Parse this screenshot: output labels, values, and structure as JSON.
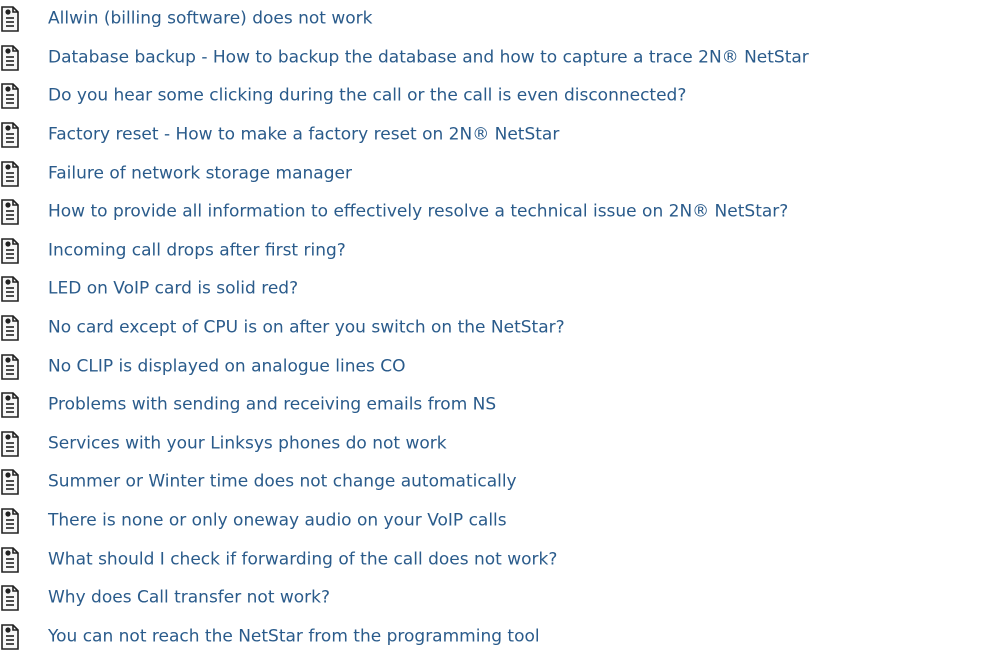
{
  "colors": {
    "link": "#2a5b8b",
    "icon": "#222222",
    "icon_fill": "#f7f7f7"
  },
  "icons": {
    "page": "page-icon"
  },
  "items": [
    {
      "label": "Allwin (billing software) does not work"
    },
    {
      "label": "Database backup - How to backup the database and how to capture a trace 2N® NetStar"
    },
    {
      "label": "Do you hear some clicking during the call or the call is even disconnected?"
    },
    {
      "label": "Factory reset - How to make a factory reset on 2N® NetStar"
    },
    {
      "label": "Failure of network storage manager"
    },
    {
      "label": "How to provide all information to effectively resolve a technical issue on 2N® NetStar?"
    },
    {
      "label": "Incoming call drops after first ring?"
    },
    {
      "label": "LED on VoIP card is solid red?"
    },
    {
      "label": "No card except of CPU is on after you switch on the NetStar?"
    },
    {
      "label": "No CLIP is displayed on analogue lines CO"
    },
    {
      "label": "Problems with sending and receiving emails from NS"
    },
    {
      "label": "Services with your Linksys phones do not work"
    },
    {
      "label": "Summer or Winter time does not change automatically"
    },
    {
      "label": "There is none or only oneway audio on your VoIP calls"
    },
    {
      "label": "What should I check if forwarding of the call does not work?"
    },
    {
      "label": "Why does Call transfer not work?"
    },
    {
      "label": "You can not reach the NetStar from the programming tool"
    }
  ]
}
